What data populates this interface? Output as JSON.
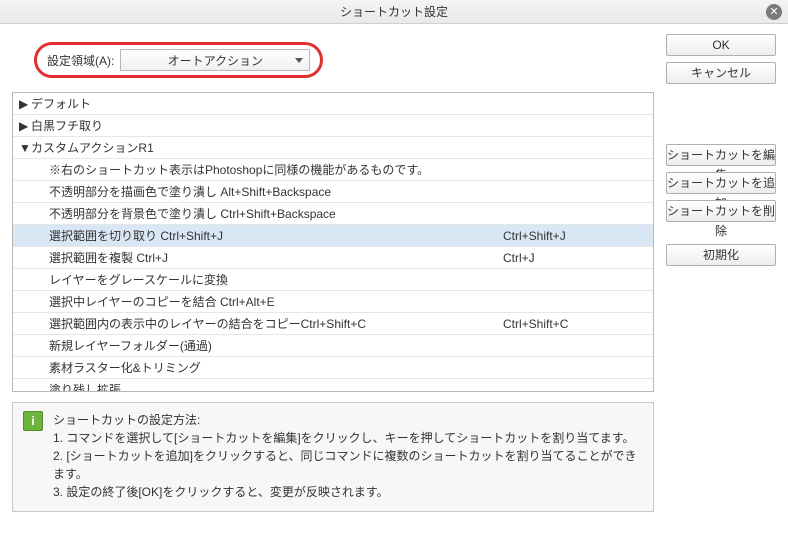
{
  "title": "ショートカット設定",
  "area": {
    "label": "設定領域(A):",
    "selected": "オートアクション"
  },
  "tree": [
    {
      "label": "デフォルト",
      "type": "closed"
    },
    {
      "label": "白黒フチ取り",
      "type": "closed"
    },
    {
      "label": "カスタムアクションR1",
      "type": "open"
    },
    {
      "label": "※右のショートカット表示はPhotoshopに同様の機能があるものです。",
      "type": "child",
      "key": ""
    },
    {
      "label": "不透明部分を描画色で塗り潰し Alt+Shift+Backspace",
      "type": "child",
      "key": ""
    },
    {
      "label": "不透明部分を背景色で塗り潰し Ctrl+Shift+Backspace",
      "type": "child",
      "key": ""
    },
    {
      "label": "選択範囲を切り取り Ctrl+Shift+J",
      "type": "child",
      "key": "Ctrl+Shift+J",
      "selected": true
    },
    {
      "label": "選択範囲を複製 Ctrl+J",
      "type": "child",
      "key": "Ctrl+J"
    },
    {
      "label": "レイヤーをグレースケールに変換",
      "type": "child",
      "key": ""
    },
    {
      "label": "選択中レイヤーのコピーを結合 Ctrl+Alt+E",
      "type": "child",
      "key": ""
    },
    {
      "label": "選択範囲内の表示中のレイヤーの結合をコピーCtrl+Shift+C",
      "type": "child",
      "key": "Ctrl+Shift+C"
    },
    {
      "label": "新規レイヤーフォルダー(通過)",
      "type": "child",
      "key": ""
    },
    {
      "label": "素材ラスター化&トリミング",
      "type": "child",
      "key": ""
    },
    {
      "label": "塗り残し拡張",
      "type": "child",
      "key": ""
    }
  ],
  "buttons": {
    "ok": "OK",
    "cancel": "キャンセル",
    "edit": "ショートカットを編集",
    "add": "ショートカットを追加",
    "del": "ショートカットを削除",
    "init": "初期化"
  },
  "info": {
    "title": "ショートカットの設定方法:",
    "l1": "1. コマンドを選択して[ショートカットを編集]をクリックし、キーを押してショートカットを割り当てます。",
    "l2": "2. [ショートカットを追加]をクリックすると、同じコマンドに複数のショートカットを割り当てることができます。",
    "l3": "3. 設定の終了後[OK]をクリックすると、変更が反映されます。"
  }
}
